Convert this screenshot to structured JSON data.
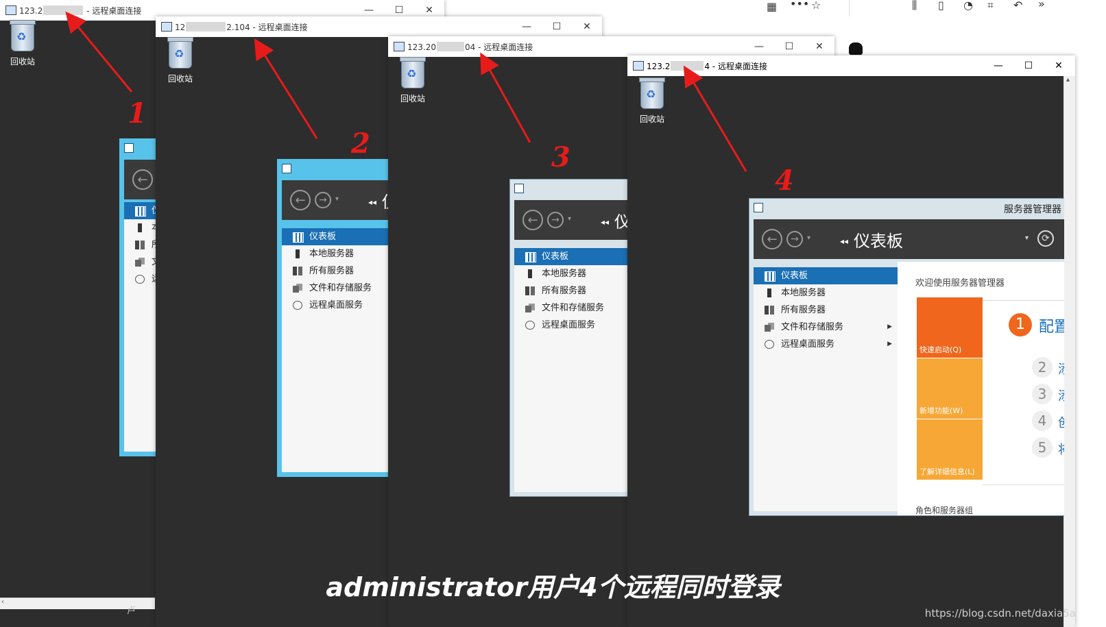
{
  "host": {
    "toolbar_icons": [
      "qr-icon",
      "more-icon",
      "star-icon",
      "library-icon",
      "reader-icon",
      "mic-icon",
      "screenshot-icon",
      "undo-icon",
      "overflow-icon",
      "avatar-icon"
    ]
  },
  "windows": [
    {
      "title_prefix": "123.2",
      "title_suffix": " - 远程桌面连接",
      "recycle_label": "回收站",
      "annotation": "1",
      "nav_fragment_1": "仪",
      "nav_fragment_2": "本",
      "nav_fragment_3": "所",
      "nav_fragment_4": "文",
      "nav_fragment_5": "远",
      "bottom_fragment": "卢"
    },
    {
      "title_prefix": "12",
      "title_suffix": "2.104 - 远程桌面连接",
      "recycle_label": "回收站",
      "annotation": "2",
      "crumb": "仪"
    },
    {
      "title_prefix": "123.20",
      "title_suffix": "04 - 远程桌面连接",
      "recycle_label": "回收站",
      "annotation": "3",
      "crumb": "仪"
    },
    {
      "title_prefix": "123.2",
      "title_suffix": "4 - 远程桌面连接",
      "recycle_label": "回收站",
      "annotation": "4"
    }
  ],
  "window_controls": {
    "minimize": "—",
    "maximize": "☐",
    "close": "✕"
  },
  "server_manager": {
    "app_name": "服务器管理器",
    "breadcrumb": "仪表板",
    "nav": [
      {
        "label": "仪表板"
      },
      {
        "label": "本地服务器"
      },
      {
        "label": "所有服务器"
      },
      {
        "label": "文件和存储服务"
      },
      {
        "label": "远程桌面服务"
      }
    ],
    "welcome": "欢迎使用服务器管理器",
    "tiles": [
      {
        "label": "快速启动(Q)",
        "color": "#f0661d"
      },
      {
        "label": "新增功能(W)",
        "color": "#f7a735"
      },
      {
        "label": "了解详细信息(L)",
        "color": "#f7a735"
      }
    ],
    "steps": [
      {
        "num": "1",
        "text": "配置"
      },
      {
        "num": "2",
        "text": "添"
      },
      {
        "num": "3",
        "text": "添"
      },
      {
        "num": "4",
        "text": "创"
      },
      {
        "num": "5",
        "text": "将"
      }
    ],
    "roles_heading": "角色和服务器组"
  },
  "caption": "administrator用户4个远程同时登录",
  "watermark": "https://blog.csdn.net/daxia5a",
  "colors": {
    "annotation_red": "#e81b1b",
    "nav_selected": "#1a6fb5",
    "desktop": "#2d2d2d"
  }
}
